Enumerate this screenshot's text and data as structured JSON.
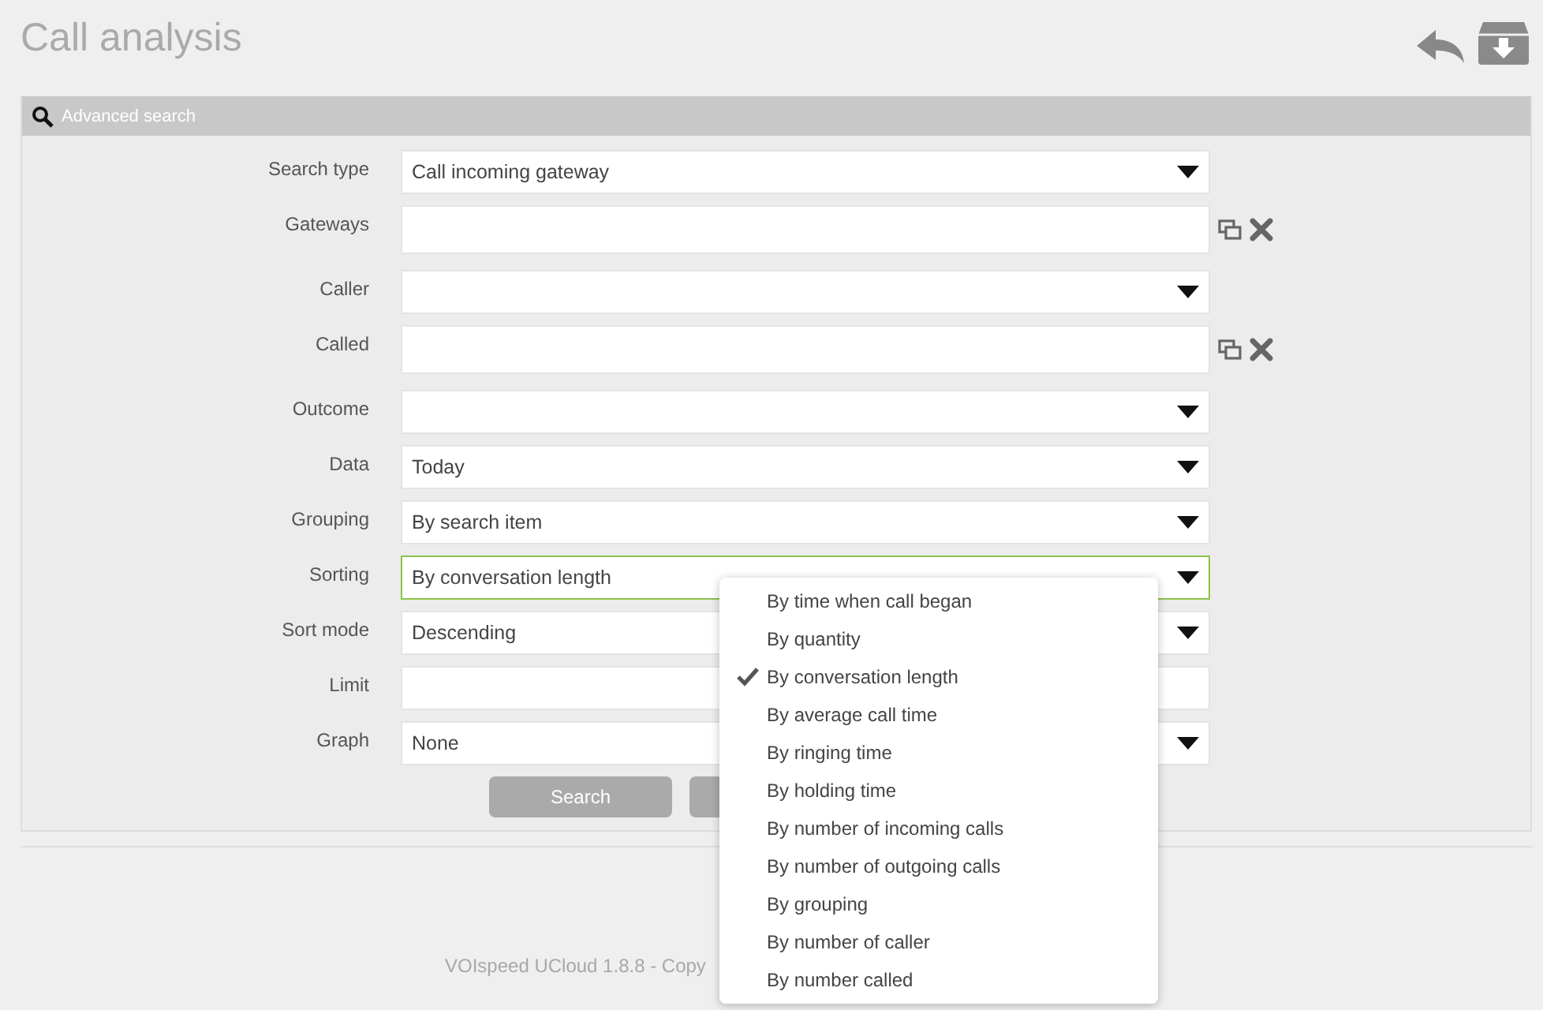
{
  "page": {
    "title": "Call analysis"
  },
  "panel": {
    "title": "Advanced search"
  },
  "fields": [
    {
      "label": "Search type",
      "kind": "select",
      "value": "Call incoming gateway",
      "focused": false
    },
    {
      "label": "Gateways",
      "kind": "multi",
      "focused": false
    },
    {
      "label": "Caller",
      "kind": "select",
      "focused": false
    },
    {
      "label": "Called",
      "kind": "multi",
      "focused": false
    },
    {
      "label": "Outcome",
      "kind": "select",
      "focused": false
    },
    {
      "label": "Data",
      "kind": "select",
      "value": "Today",
      "focused": false
    },
    {
      "label": "Grouping",
      "kind": "select",
      "value": "By search item",
      "focused": false
    },
    {
      "label": "Sorting",
      "kind": "select",
      "value": "By conversation length",
      "focused": true
    },
    {
      "label": "Sort mode",
      "kind": "select",
      "value": "Descending",
      "focused": false
    },
    {
      "label": "Limit",
      "kind": "text",
      "focused": false
    },
    {
      "label": "Graph",
      "kind": "select",
      "value": "None",
      "focused": false
    }
  ],
  "buttons": [
    {
      "label": "Search"
    }
  ],
  "dropdown": {
    "items": [
      {
        "label": "By time when call began",
        "selected": false
      },
      {
        "label": "By quantity",
        "selected": false
      },
      {
        "label": "By conversation length",
        "selected": true
      },
      {
        "label": "By average call time",
        "selected": false
      },
      {
        "label": "By ringing time",
        "selected": false
      },
      {
        "label": "By holding time",
        "selected": false
      },
      {
        "label": "By number of incoming calls",
        "selected": false
      },
      {
        "label": "By number of outgoing calls",
        "selected": false
      },
      {
        "label": "By grouping",
        "selected": false
      },
      {
        "label": "By number of caller",
        "selected": false
      },
      {
        "label": "By number called",
        "selected": false
      }
    ]
  },
  "footer": {
    "text": "VOIspeed UCloud 1.8.8 - Copy"
  }
}
